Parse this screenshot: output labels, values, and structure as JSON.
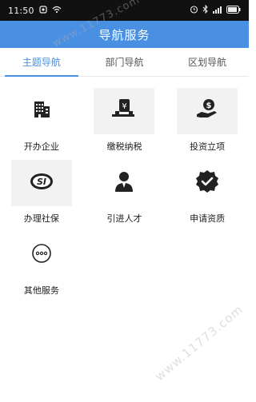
{
  "status_bar": {
    "time": "11:50"
  },
  "header": {
    "title": "导航服务"
  },
  "tabs": [
    {
      "label": "主题导航",
      "active": true
    },
    {
      "label": "部门导航",
      "active": false
    },
    {
      "label": "区划导航",
      "active": false
    }
  ],
  "services": [
    {
      "label": "开办企业",
      "icon": "building-icon",
      "shaded": false
    },
    {
      "label": "缴税纳税",
      "icon": "tax-payment-icon",
      "shaded": true
    },
    {
      "label": "投资立项",
      "icon": "investment-icon",
      "shaded": true
    },
    {
      "label": "办理社保",
      "icon": "social-security-icon",
      "shaded": true
    },
    {
      "label": "引进人才",
      "icon": "talent-icon",
      "shaded": false
    },
    {
      "label": "申请资质",
      "icon": "qualification-icon",
      "shaded": false
    },
    {
      "label": "其他服务",
      "icon": "more-services-icon",
      "shaded": false
    }
  ],
  "watermarks": {
    "top": "www.11773.com",
    "bottom": "www.11773.com"
  },
  "colors": {
    "accent": "#4a90e2",
    "status_bar": "#111111",
    "shaded_tile": "#f2f2f2"
  }
}
